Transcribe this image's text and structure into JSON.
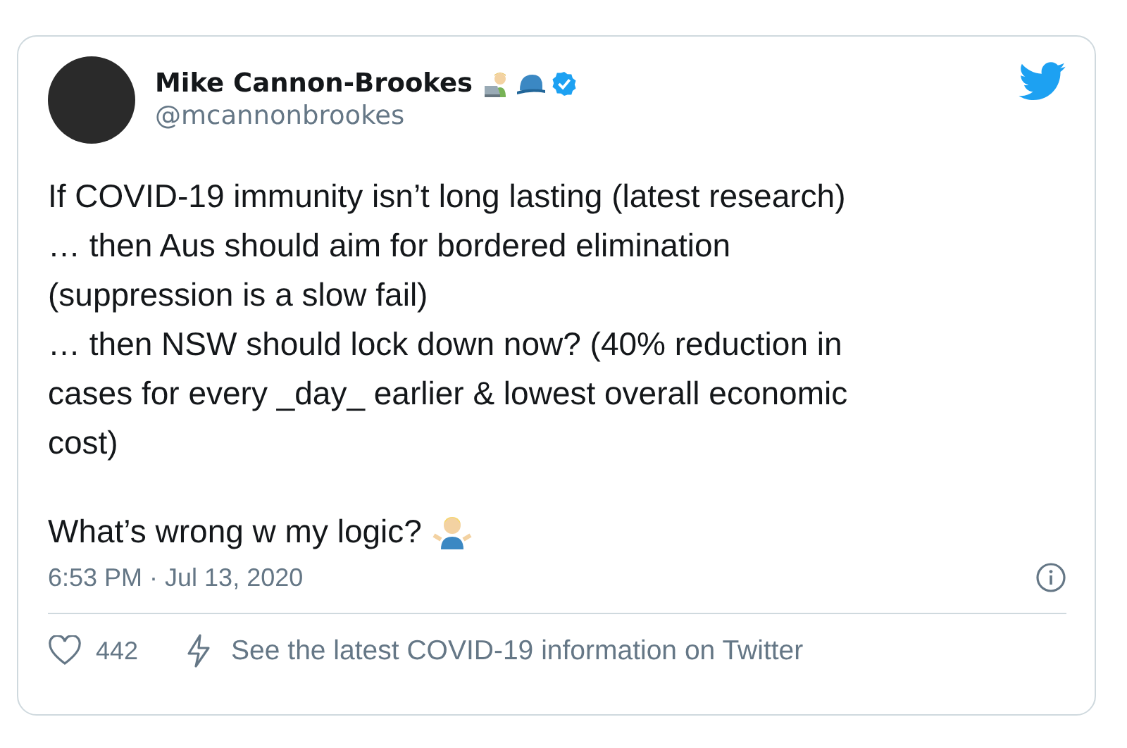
{
  "author": {
    "name": "Mike Cannon-Brookes",
    "handle": "@mcannonbrookes",
    "verified": true
  },
  "text": "If COVID-19 immunity isn’t long lasting (latest research)\n… then Aus should aim for bordered elimination\n(suppression is a slow fail)\n… then NSW should lock down now? (40% reduction in cases for every _day_ earlier & lowest overall economic cost)",
  "closing": "What’s wrong w my logic?",
  "timestamp": "6:53 PM · Jul 13, 2020",
  "likes": "442",
  "info_link": "See the latest COVID-19 information on Twitter"
}
